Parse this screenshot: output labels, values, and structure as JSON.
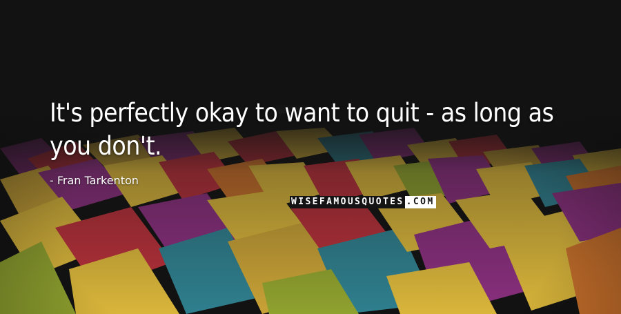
{
  "quote": {
    "text": "It's perfectly okay to want to quit - as long as you don't.",
    "author": "- Fran Tarkenton"
  },
  "watermark": {
    "part1": "WISEFAMOUSQUOTES",
    "part2": ".COM"
  },
  "colors": {
    "background": "#121212",
    "text": "#ffffff",
    "cube_yellow": "#d9b53a",
    "cube_purple": "#8a2f7e",
    "cube_red": "#b7303a",
    "cube_teal": "#2f7f8e",
    "cube_orange": "#c9702a",
    "cube_green": "#8fa12e"
  }
}
